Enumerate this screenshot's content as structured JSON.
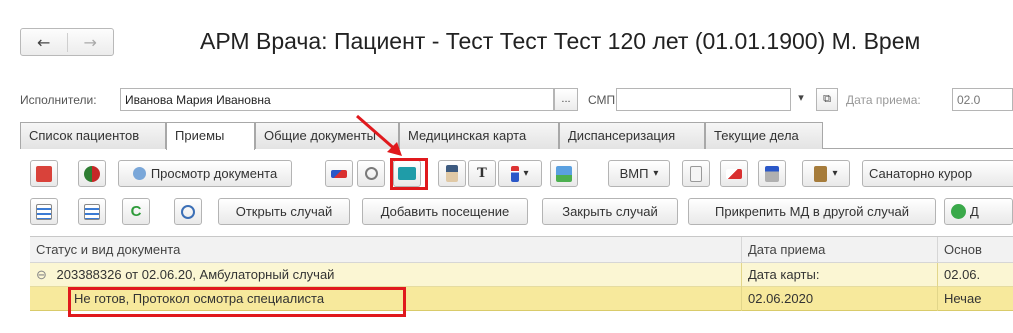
{
  "window": {
    "title": "АРМ Врача: Пациент - Тест Тест Тест 120 лет  (01.01.1900) М. Врем",
    "nav_back": "←",
    "nav_forward": "→"
  },
  "filters": {
    "executors_label": "Исполнители:",
    "executors_value": "Иванова Мария Ивановна",
    "executors_select": "...",
    "smp_label": "СМП:",
    "smp_value": "",
    "smp_dropdown": "▾",
    "smp_open": "⧉",
    "date_label": "Дата приема:",
    "date_value": "02.0"
  },
  "tabs": [
    {
      "label": "Список пациентов"
    },
    {
      "label": "Приемы"
    },
    {
      "label": "Общие документы"
    },
    {
      "label": "Медицинская карта"
    },
    {
      "label": "Диспансеризация"
    },
    {
      "label": "Текущие дела"
    }
  ],
  "toolbar1": {
    "view_document": "Просмотр документа",
    "text_tool": "T",
    "vmp": "ВМП",
    "dropdown": "▾",
    "sanatorium": "Санаторно курор"
  },
  "toolbar2": {
    "refresh": "C",
    "open_case": "Открыть случай",
    "add_visit": "Добавить посещение",
    "close_case": "Закрыть случай",
    "attach_md": "Прикрепить МД в другой случай",
    "add_partial": "Д"
  },
  "grid": {
    "columns": [
      "Статус и вид документа",
      "Дата приема",
      "Основ"
    ],
    "group_row": {
      "toggle": "⊖",
      "label": "203388326 от 02.06.20, Амбулаторный случай",
      "date": "Дата карты:",
      "extra": "02.06."
    },
    "row": {
      "label": "Не готов, Протокол осмотра специалиста",
      "date": "02.06.2020",
      "extra": "Нечае"
    }
  },
  "colors": {
    "highlight": "#e0191d",
    "selected_row": "#f7e99c",
    "group_row": "#fbf6d3"
  }
}
